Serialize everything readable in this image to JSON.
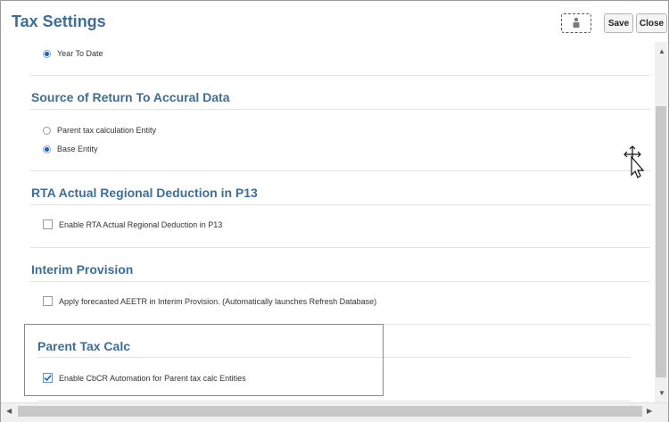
{
  "header": {
    "title": "Tax Settings",
    "save_label": "Save",
    "close_label": "Close",
    "icon": "personalize-icon"
  },
  "sections": {
    "ytd": {
      "option": "Year To Date"
    },
    "source": {
      "title": "Source of Return To Accural Data",
      "option1": "Parent tax calculation Entity",
      "option2": "Base Entity"
    },
    "rta": {
      "title": "RTA Actual Regional Deduction in P13",
      "checkbox": "Enable RTA Actual Regional Deduction in P13"
    },
    "interim": {
      "title": "Interim Provision",
      "checkbox": "Apply forecasted AEETR in Interim Provision. (Automatically launches Refresh Database)"
    },
    "parent": {
      "title": "Parent Tax Calc",
      "checkbox": "Enable CbCR Automation for Parent tax calc Entities"
    }
  },
  "state": {
    "ytd_selected": true,
    "source_selected": "Base Entity",
    "rta_checked": false,
    "interim_checked": false,
    "parent_checked": true
  },
  "colors": {
    "title": "#3e6e96",
    "highlight": "#e06666",
    "radio_selected": "#1a5fb4"
  }
}
